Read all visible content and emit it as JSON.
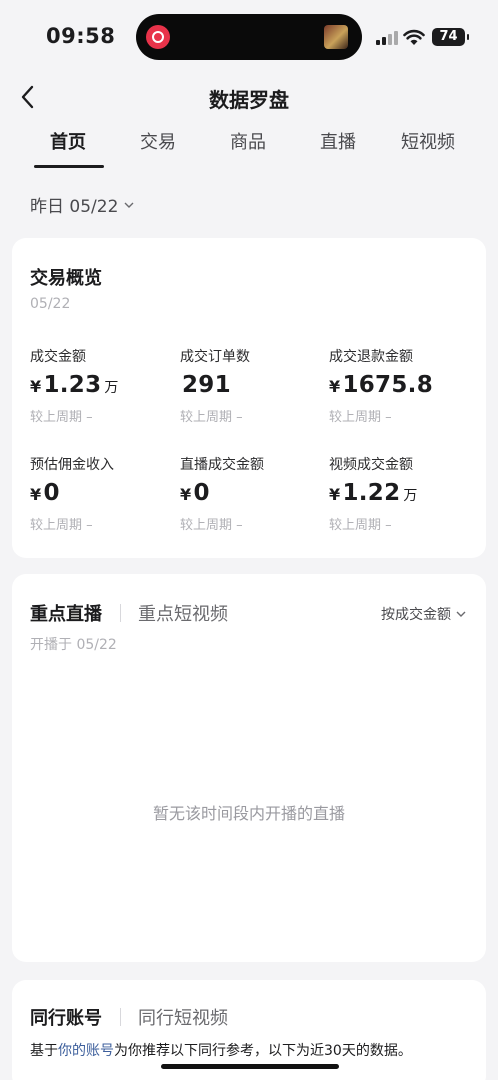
{
  "status_bar": {
    "time": "09:58",
    "battery": "74"
  },
  "nav": {
    "title": "数据罗盘"
  },
  "tabs": [
    "首页",
    "交易",
    "商品",
    "直播",
    "短视频"
  ],
  "date_picker": {
    "label": "昨日 05/22"
  },
  "trade_overview": {
    "title": "交易概览",
    "date": "05/22",
    "metrics": [
      {
        "label": "成交金额",
        "currency": "¥",
        "value": "1.23",
        "unit": "万",
        "compare": "较上周期 –"
      },
      {
        "label": "成交订单数",
        "currency": "",
        "value": "291",
        "unit": "",
        "compare": "较上周期 –"
      },
      {
        "label": "成交退款金额",
        "currency": "¥",
        "value": "1675.8",
        "unit": "",
        "compare": "较上周期 –"
      },
      {
        "label": "预估佣金收入",
        "currency": "¥",
        "value": "0",
        "unit": "",
        "compare": "较上周期 –"
      },
      {
        "label": "直播成交金额",
        "currency": "¥",
        "value": "0",
        "unit": "",
        "compare": "较上周期 –"
      },
      {
        "label": "视频成交金额",
        "currency": "¥",
        "value": "1.22",
        "unit": "万",
        "compare": "较上周期 –"
      }
    ]
  },
  "key_section": {
    "tab_active": "重点直播",
    "tab_inactive": "重点短视频",
    "sort_label": "按成交金额",
    "start_date": "开播于 05/22",
    "empty_text": "暂无该时间段内开播的直播"
  },
  "peer_section": {
    "tab_active": "同行账号",
    "tab_inactive": "同行短视频",
    "desc_prefix": "基于",
    "desc_link": "你的账号",
    "desc_suffix": "为你推荐以下同行参考，以下为近30天的数据。"
  },
  "colors": {
    "link": "#3d5f9c",
    "background": "#f4f4f6",
    "island_app": "#e8334a"
  }
}
